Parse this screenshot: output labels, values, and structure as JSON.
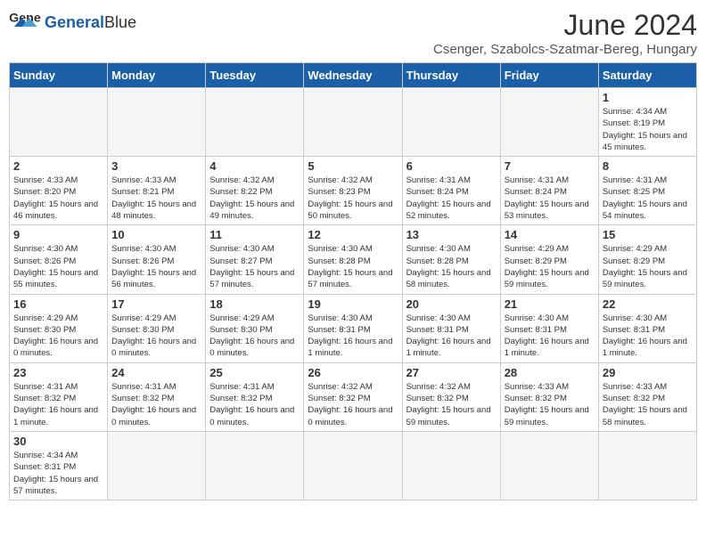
{
  "header": {
    "logo_general": "General",
    "logo_blue": "Blue",
    "month_year": "June 2024",
    "location": "Csenger, Szabolcs-Szatmar-Bereg, Hungary"
  },
  "weekdays": [
    "Sunday",
    "Monday",
    "Tuesday",
    "Wednesday",
    "Thursday",
    "Friday",
    "Saturday"
  ],
  "weeks": [
    [
      {
        "day": null
      },
      {
        "day": null
      },
      {
        "day": null
      },
      {
        "day": null
      },
      {
        "day": null
      },
      {
        "day": null
      },
      {
        "day": 1,
        "info": "Sunrise: 4:34 AM\nSunset: 8:19 PM\nDaylight: 15 hours and 45 minutes."
      }
    ],
    [
      {
        "day": 2,
        "info": "Sunrise: 4:33 AM\nSunset: 8:20 PM\nDaylight: 15 hours and 46 minutes."
      },
      {
        "day": 3,
        "info": "Sunrise: 4:33 AM\nSunset: 8:21 PM\nDaylight: 15 hours and 48 minutes."
      },
      {
        "day": 4,
        "info": "Sunrise: 4:32 AM\nSunset: 8:22 PM\nDaylight: 15 hours and 49 minutes."
      },
      {
        "day": 5,
        "info": "Sunrise: 4:32 AM\nSunset: 8:23 PM\nDaylight: 15 hours and 50 minutes."
      },
      {
        "day": 6,
        "info": "Sunrise: 4:31 AM\nSunset: 8:24 PM\nDaylight: 15 hours and 52 minutes."
      },
      {
        "day": 7,
        "info": "Sunrise: 4:31 AM\nSunset: 8:24 PM\nDaylight: 15 hours and 53 minutes."
      },
      {
        "day": 8,
        "info": "Sunrise: 4:31 AM\nSunset: 8:25 PM\nDaylight: 15 hours and 54 minutes."
      }
    ],
    [
      {
        "day": 9,
        "info": "Sunrise: 4:30 AM\nSunset: 8:26 PM\nDaylight: 15 hours and 55 minutes."
      },
      {
        "day": 10,
        "info": "Sunrise: 4:30 AM\nSunset: 8:26 PM\nDaylight: 15 hours and 56 minutes."
      },
      {
        "day": 11,
        "info": "Sunrise: 4:30 AM\nSunset: 8:27 PM\nDaylight: 15 hours and 57 minutes."
      },
      {
        "day": 12,
        "info": "Sunrise: 4:30 AM\nSunset: 8:28 PM\nDaylight: 15 hours and 57 minutes."
      },
      {
        "day": 13,
        "info": "Sunrise: 4:30 AM\nSunset: 8:28 PM\nDaylight: 15 hours and 58 minutes."
      },
      {
        "day": 14,
        "info": "Sunrise: 4:29 AM\nSunset: 8:29 PM\nDaylight: 15 hours and 59 minutes."
      },
      {
        "day": 15,
        "info": "Sunrise: 4:29 AM\nSunset: 8:29 PM\nDaylight: 15 hours and 59 minutes."
      }
    ],
    [
      {
        "day": 16,
        "info": "Sunrise: 4:29 AM\nSunset: 8:30 PM\nDaylight: 16 hours and 0 minutes."
      },
      {
        "day": 17,
        "info": "Sunrise: 4:29 AM\nSunset: 8:30 PM\nDaylight: 16 hours and 0 minutes."
      },
      {
        "day": 18,
        "info": "Sunrise: 4:29 AM\nSunset: 8:30 PM\nDaylight: 16 hours and 0 minutes."
      },
      {
        "day": 19,
        "info": "Sunrise: 4:30 AM\nSunset: 8:31 PM\nDaylight: 16 hours and 1 minute."
      },
      {
        "day": 20,
        "info": "Sunrise: 4:30 AM\nSunset: 8:31 PM\nDaylight: 16 hours and 1 minute."
      },
      {
        "day": 21,
        "info": "Sunrise: 4:30 AM\nSunset: 8:31 PM\nDaylight: 16 hours and 1 minute."
      },
      {
        "day": 22,
        "info": "Sunrise: 4:30 AM\nSunset: 8:31 PM\nDaylight: 16 hours and 1 minute."
      }
    ],
    [
      {
        "day": 23,
        "info": "Sunrise: 4:31 AM\nSunset: 8:32 PM\nDaylight: 16 hours and 1 minute."
      },
      {
        "day": 24,
        "info": "Sunrise: 4:31 AM\nSunset: 8:32 PM\nDaylight: 16 hours and 0 minutes."
      },
      {
        "day": 25,
        "info": "Sunrise: 4:31 AM\nSunset: 8:32 PM\nDaylight: 16 hours and 0 minutes."
      },
      {
        "day": 26,
        "info": "Sunrise: 4:32 AM\nSunset: 8:32 PM\nDaylight: 16 hours and 0 minutes."
      },
      {
        "day": 27,
        "info": "Sunrise: 4:32 AM\nSunset: 8:32 PM\nDaylight: 15 hours and 59 minutes."
      },
      {
        "day": 28,
        "info": "Sunrise: 4:33 AM\nSunset: 8:32 PM\nDaylight: 15 hours and 59 minutes."
      },
      {
        "day": 29,
        "info": "Sunrise: 4:33 AM\nSunset: 8:32 PM\nDaylight: 15 hours and 58 minutes."
      }
    ],
    [
      {
        "day": 30,
        "info": "Sunrise: 4:34 AM\nSunset: 8:31 PM\nDaylight: 15 hours and 57 minutes."
      },
      {
        "day": null
      },
      {
        "day": null
      },
      {
        "day": null
      },
      {
        "day": null
      },
      {
        "day": null
      },
      {
        "day": null
      }
    ]
  ]
}
